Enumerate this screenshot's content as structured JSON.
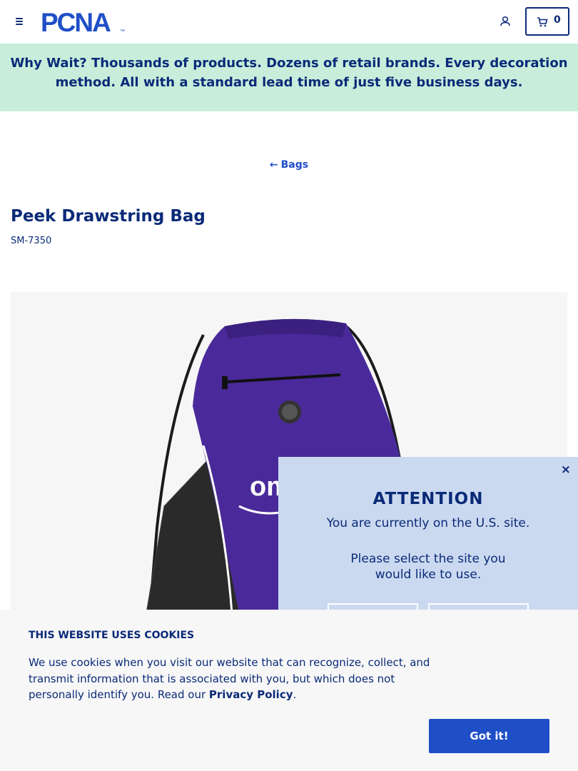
{
  "header": {
    "logo_text": "PCNA",
    "logo_mark": "™",
    "cart_count": "0"
  },
  "promo": {
    "lead": "Why Wait?",
    "text": "Thousands of products. Dozens of retail brands. Every decoration method. All with a standard lead time of just five business days."
  },
  "breadcrumb": {
    "arrow": "←",
    "label": "Bags"
  },
  "product": {
    "title": "Peek Drawstring Bag",
    "sku": "SM-7350",
    "bag_color": "#4a2a9a",
    "imprint_text": "om"
  },
  "geo_modal": {
    "close": "×",
    "title": "ATTENTION",
    "current_site": "You are currently on the U.S. site.",
    "prompt": "Please select the site you would like to use."
  },
  "cookie_banner": {
    "title": "THIS WEBSITE USES COOKIES",
    "text_before": "We use cookies when you visit our website that can recognize, collect, and transmit information that is associated with you, but which does not personally identify you. Read our ",
    "link": "Privacy Policy",
    "text_after": ".",
    "button": "Got it!"
  },
  "colors": {
    "navy": "#0a2a78",
    "link_blue": "#1f4fc7",
    "promo_bg": "#c8eedb",
    "modal_bg": "#cbd9f0"
  }
}
